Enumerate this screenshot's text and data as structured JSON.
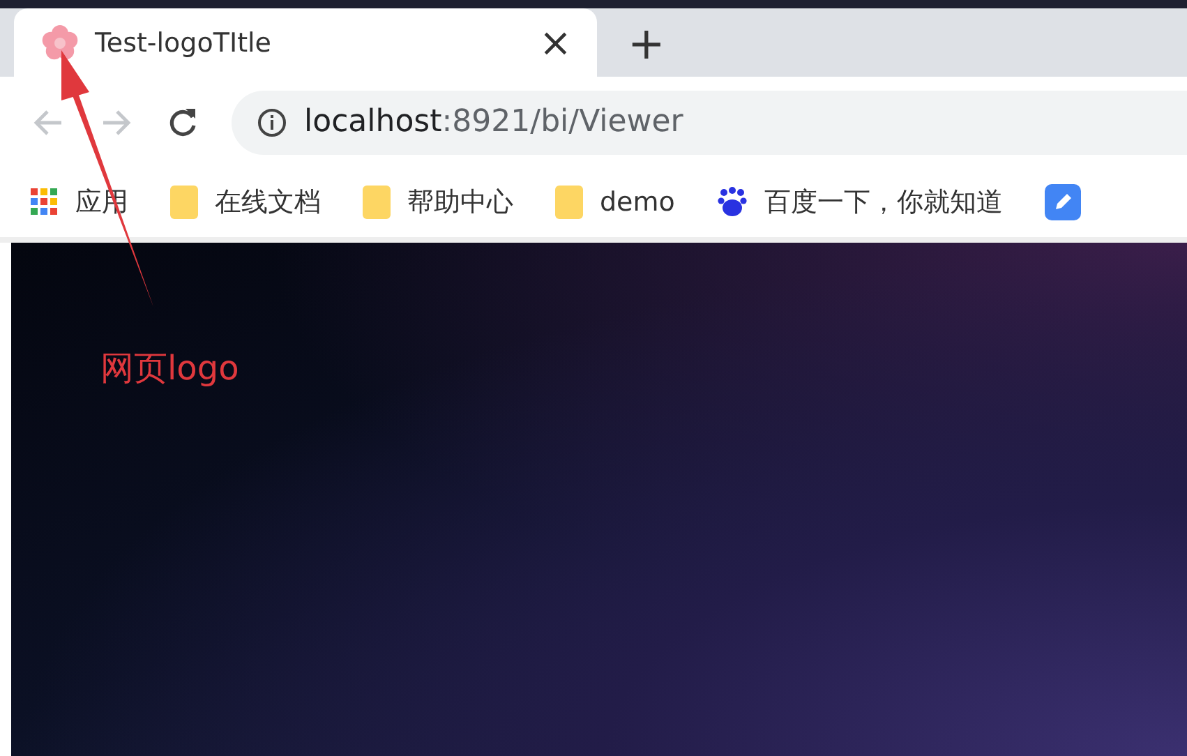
{
  "tab": {
    "title": "Test-logoTItle",
    "close": "×",
    "selected": true
  },
  "new_tab": "+",
  "address_bar": {
    "host": "localhost",
    "path": ":8921/bi/Viewer"
  },
  "bookmarks": [
    {
      "kind": "apps",
      "label": "应用"
    },
    {
      "kind": "folder",
      "label": "在线文档"
    },
    {
      "kind": "folder",
      "label": "帮助中心"
    },
    {
      "kind": "folder",
      "label": "demo"
    },
    {
      "kind": "paw",
      "label": "百度一下，你就知道"
    },
    {
      "kind": "app"
    }
  ],
  "annotation": {
    "label": "网页logo"
  }
}
